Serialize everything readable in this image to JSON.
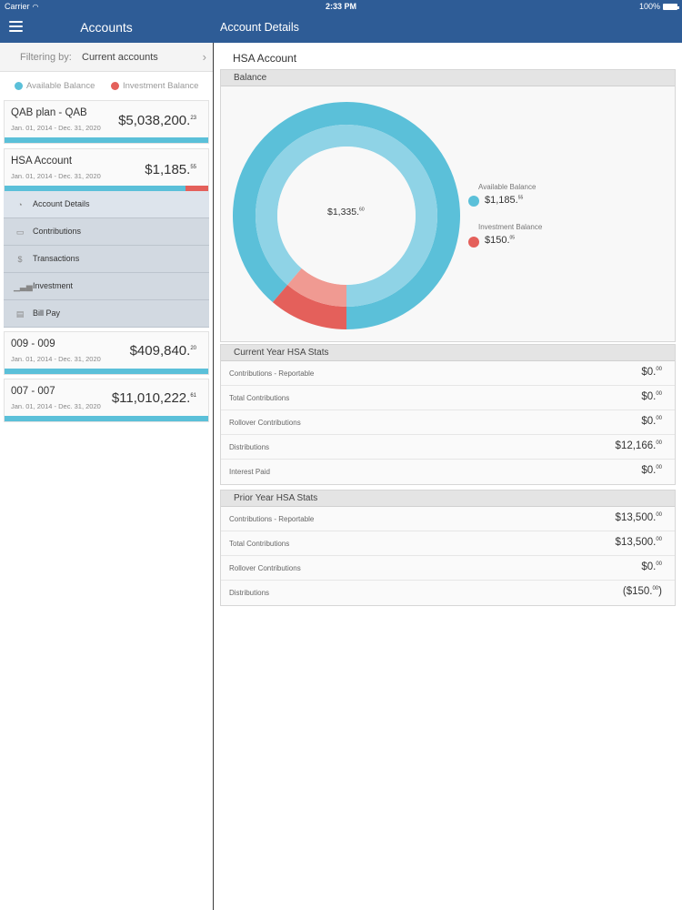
{
  "status": {
    "carrier": "Carrier",
    "time": "2:33 PM",
    "battery": "100%"
  },
  "header": {
    "left_title": "Accounts",
    "right_title": "Account Details"
  },
  "filter": {
    "label": "Filtering by:",
    "value": "Current accounts"
  },
  "legend": {
    "available": "Available Balance",
    "investment": "Investment Balance"
  },
  "colors": {
    "available": "#5bc0d9",
    "investment": "#e4605b",
    "header": "#2e5c96"
  },
  "accounts": [
    {
      "name": "QAB plan - QAB",
      "dates": "Jan. 01, 2014 - Dec. 31, 2020",
      "amount": "$5,038,200.",
      "cents": "23"
    },
    {
      "name": "HSA Account",
      "dates": "Jan. 01, 2014 - Dec. 31, 2020",
      "amount": "$1,185.",
      "cents": "55"
    },
    {
      "name": "009 - 009",
      "dates": "Jan. 01, 2014 - Dec. 31, 2020",
      "amount": "$409,840.",
      "cents": "20"
    },
    {
      "name": "007 - 007",
      "dates": "Jan. 01, 2014 - Dec. 31, 2020",
      "amount": "$11,010,222.",
      "cents": "61"
    }
  ],
  "submenu": [
    {
      "label": "Account Details",
      "icon": "pie-chart-icon"
    },
    {
      "label": "Contributions",
      "icon": "money-icon"
    },
    {
      "label": "Transactions",
      "icon": "dollar-circle-icon"
    },
    {
      "label": "Investment",
      "icon": "growth-chart-icon"
    },
    {
      "label": "Bill Pay",
      "icon": "bill-icon"
    }
  ],
  "detail": {
    "title": "HSA Account",
    "balance_header": "Balance",
    "center": {
      "amount": "$1,335.",
      "cents": "60"
    },
    "available": {
      "label": "Available Balance",
      "amount": "$1,185.",
      "cents": "55"
    },
    "investment": {
      "label": "Investment Balance",
      "amount": "$150.",
      "cents": "05"
    }
  },
  "chart_data": {
    "type": "pie",
    "categories": [
      "Available Balance",
      "Investment Balance"
    ],
    "values": [
      1185.55,
      150.05
    ],
    "colors": [
      "#5bc0d9",
      "#e4605b"
    ]
  },
  "current_stats": {
    "header": "Current Year HSA Stats",
    "rows": [
      {
        "label": "Contributions - Reportable",
        "value": "$0.",
        "cents": "00"
      },
      {
        "label": "Total Contributions",
        "value": "$0.",
        "cents": "00"
      },
      {
        "label": "Rollover Contributions",
        "value": "$0.",
        "cents": "00"
      },
      {
        "label": "Distributions",
        "value": "$12,166.",
        "cents": "00"
      },
      {
        "label": "Interest Paid",
        "value": "$0.",
        "cents": "00"
      }
    ]
  },
  "prior_stats": {
    "header": "Prior Year HSA Stats",
    "rows": [
      {
        "label": "Contributions - Reportable",
        "value": "$13,500.",
        "cents": "00"
      },
      {
        "label": "Total Contributions",
        "value": "$13,500.",
        "cents": "00"
      },
      {
        "label": "Rollover Contributions",
        "value": "$0.",
        "cents": "00"
      },
      {
        "label": "Distributions",
        "value": "($150.",
        "cents": "00",
        "suffix": ")"
      }
    ]
  }
}
